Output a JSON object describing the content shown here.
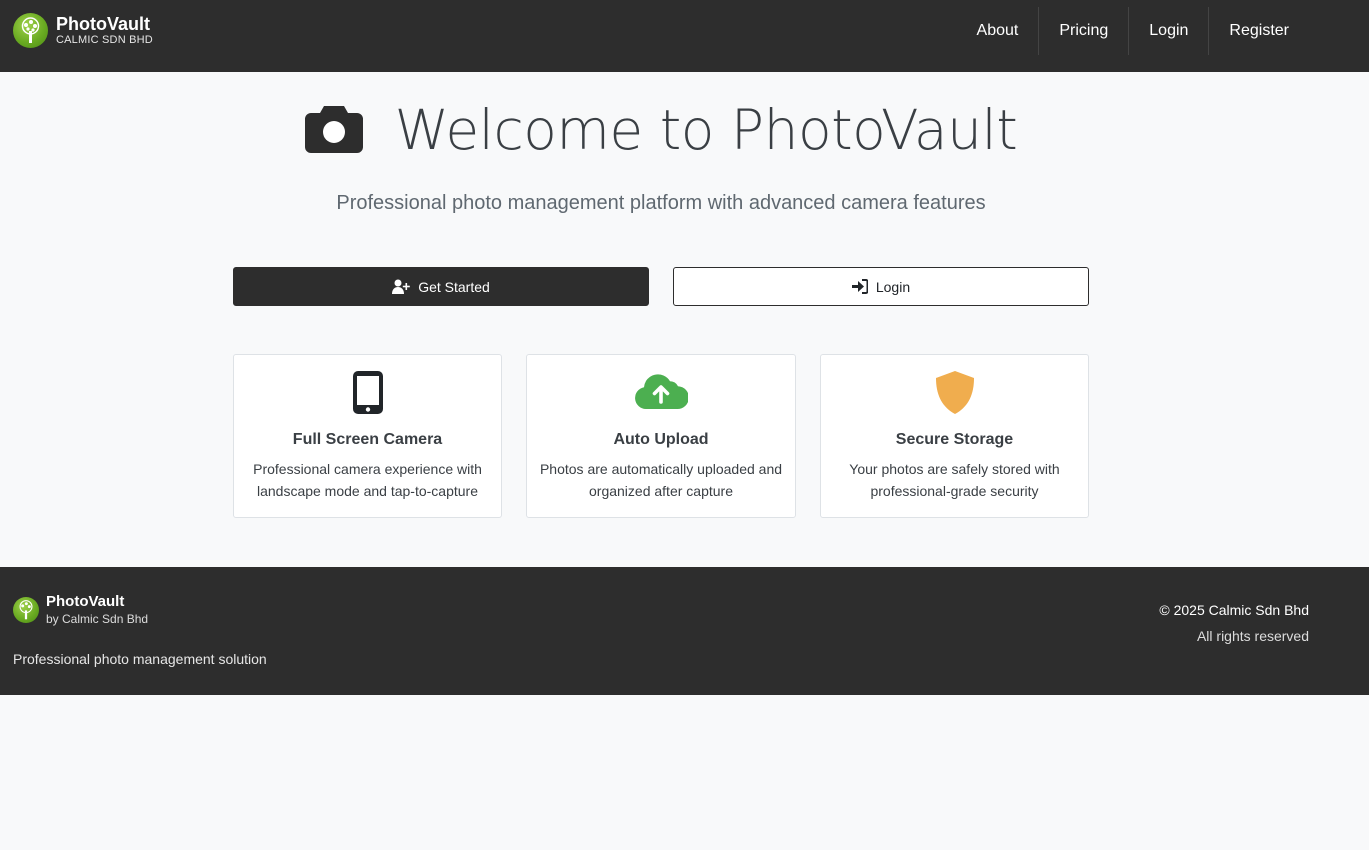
{
  "navbar": {
    "brand_name": "PhotoVault",
    "brand_sub": "CALMIC SDN BHD",
    "links": [
      "About",
      "Pricing",
      "Login",
      "Register"
    ]
  },
  "hero": {
    "title": "Welcome to PhotoVault",
    "subtitle": "Professional photo management platform with advanced camera features",
    "icon": "camera-icon"
  },
  "buttons": {
    "get_started": "Get Started",
    "login": "Login"
  },
  "features": [
    {
      "icon": "mobile-icon",
      "title": "Full Screen Camera",
      "text": "Professional camera experience with landscape mode and tap-to-capture",
      "color": "#212529"
    },
    {
      "icon": "cloud-upload-icon",
      "title": "Auto Upload",
      "text": "Photos are automatically uploaded and organized after capture",
      "color": "#4caf50"
    },
    {
      "icon": "shield-icon",
      "title": "Secure Storage",
      "text": "Your photos are safely stored with professional-grade security",
      "color": "#f0ad4e"
    }
  ],
  "footer": {
    "name": "PhotoVault",
    "by": "by Calmic Sdn Bhd",
    "description": "Professional photo management solution",
    "copyright": "© 2025 Calmic Sdn Bhd",
    "rights": "All rights reserved"
  }
}
